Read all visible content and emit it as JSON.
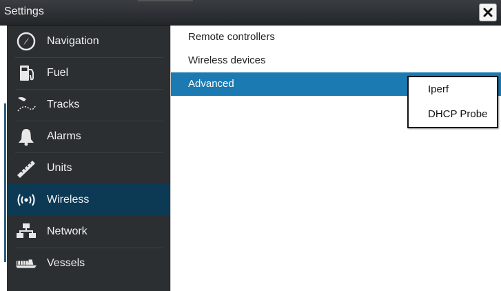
{
  "window": {
    "title": "Settings",
    "close_glyph": "✕"
  },
  "sidebar": {
    "items": [
      {
        "label": "Navigation",
        "icon": "compass-icon"
      },
      {
        "label": "Fuel",
        "icon": "fuel-pump-icon"
      },
      {
        "label": "Tracks",
        "icon": "tracks-icon"
      },
      {
        "label": "Alarms",
        "icon": "bell-icon"
      },
      {
        "label": "Units",
        "icon": "ruler-icon"
      },
      {
        "label": "Wireless",
        "icon": "wireless-icon",
        "selected": true
      },
      {
        "label": "Network",
        "icon": "network-icon"
      },
      {
        "label": "Vessels",
        "icon": "vessels-icon"
      }
    ]
  },
  "content": {
    "items": [
      {
        "label": "Remote controllers"
      },
      {
        "label": "Wireless devices"
      },
      {
        "label": "Advanced",
        "selected": true
      }
    ]
  },
  "popup": {
    "items": [
      {
        "label": "Iperf"
      },
      {
        "label": "DHCP Probe"
      }
    ]
  },
  "colors": {
    "title_bar": "#2b2f32",
    "sidebar_bg": "#2b2f32",
    "sidebar_selected": "#0c3a55",
    "menu_selected": "#1a7ab1"
  }
}
